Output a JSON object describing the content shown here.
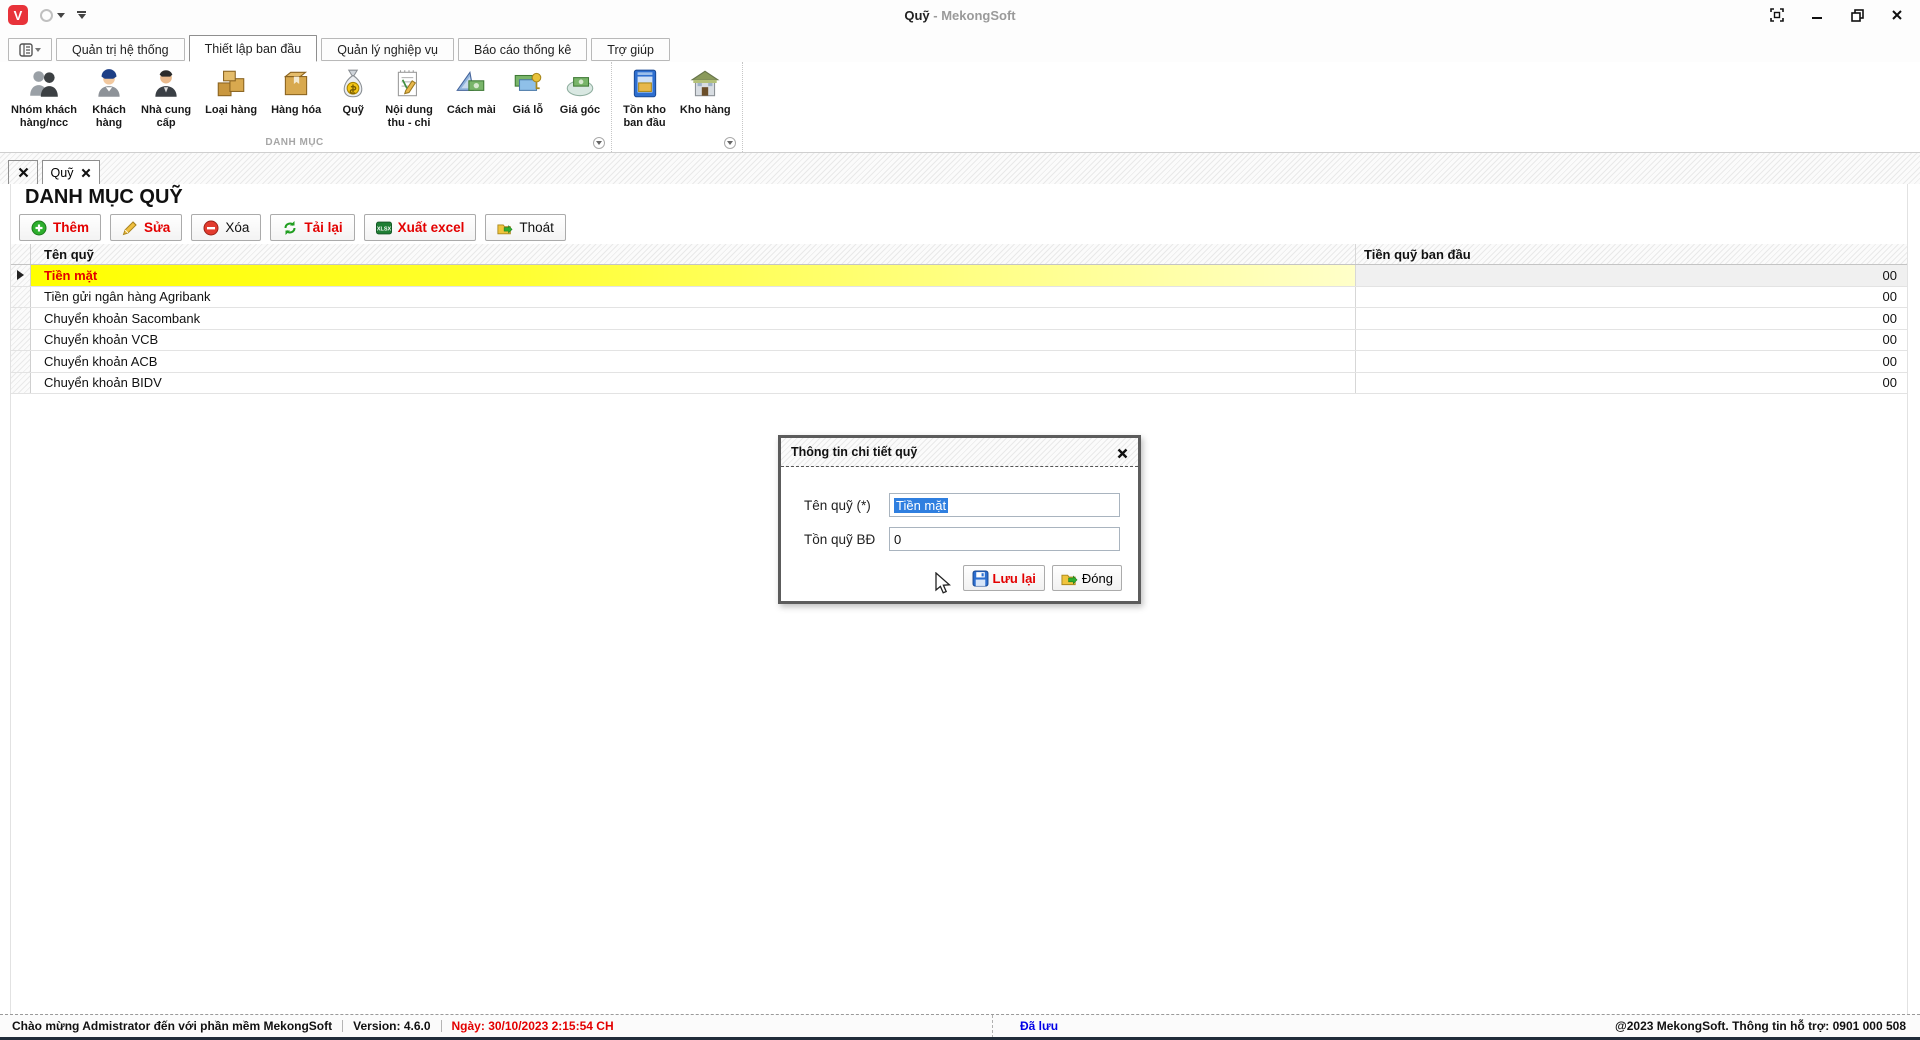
{
  "window": {
    "title": "Quỹ",
    "title_suffix": " - MekongSoft"
  },
  "menu_tabs": {
    "items": [
      {
        "label": "Quản trị hệ thống",
        "active": false
      },
      {
        "label": "Thiết lập ban đầu",
        "active": true
      },
      {
        "label": "Quản lý nghiệp vụ",
        "active": false
      },
      {
        "label": "Báo cáo thống kê",
        "active": false
      },
      {
        "label": "Trợ giúp",
        "active": false
      }
    ]
  },
  "ribbon": {
    "group_label": "DANH MỤC",
    "items": [
      {
        "label": "Nhóm khách\nhàng/ncc",
        "icon": "customers-group-icon",
        "group": 1
      },
      {
        "label": "Khách\nhàng",
        "icon": "customer-icon",
        "group": 1
      },
      {
        "label": "Nhà cung\ncấp",
        "icon": "supplier-icon",
        "group": 1
      },
      {
        "label": "Loại hàng",
        "icon": "item-type-icon",
        "group": 1
      },
      {
        "label": "Hàng hóa",
        "icon": "goods-icon",
        "group": 1
      },
      {
        "label": "Quỹ",
        "icon": "fund-icon",
        "group": 1
      },
      {
        "label": "Nội dung\nthu - chi",
        "icon": "income-expense-icon",
        "group": 1
      },
      {
        "label": "Cách mài",
        "icon": "promotion-icon",
        "group": 1
      },
      {
        "label": "Giá lỗ",
        "icon": "retail-price-icon",
        "group": 1
      },
      {
        "label": "Giá góc",
        "icon": "cost-price-icon",
        "group": 1
      },
      {
        "label": "Tồn kho\nban đầu",
        "icon": "initial-stock-icon",
        "group": 2
      },
      {
        "label": "Kho hàng",
        "icon": "warehouse-icon",
        "group": 2
      }
    ]
  },
  "doc_tabs": {
    "active_label": "Quỹ"
  },
  "page": {
    "title": "DANH MỤC QUỸ"
  },
  "actions": [
    {
      "label": "Thêm",
      "icon": "add-icon",
      "emphasis": true
    },
    {
      "label": "Sửa",
      "icon": "edit-icon",
      "emphasis": true
    },
    {
      "label": "Xóa",
      "icon": "delete-icon",
      "emphasis": false
    },
    {
      "label": "Tải lại",
      "icon": "reload-icon",
      "emphasis": true
    },
    {
      "label": "Xuất excel",
      "icon": "excel-icon",
      "emphasis": true
    },
    {
      "label": "Thoát",
      "icon": "exit-icon",
      "emphasis": false
    }
  ],
  "table": {
    "columns": [
      "Tên quỹ",
      "Tiền quỹ ban đầu"
    ],
    "rows": [
      {
        "name": "Tiền mặt",
        "initial_fund": "00",
        "selected": true
      },
      {
        "name": "Tiền gửi ngân hàng Agribank",
        "initial_fund": "00",
        "selected": false
      },
      {
        "name": "Chuyển khoản Sacombank",
        "initial_fund": "00",
        "selected": false
      },
      {
        "name": "Chuyển khoản VCB",
        "initial_fund": "00",
        "selected": false
      },
      {
        "name": "Chuyển khoản ACB",
        "initial_fund": "00",
        "selected": false
      },
      {
        "name": "Chuyển khoản BIDV",
        "initial_fund": "00",
        "selected": false
      }
    ]
  },
  "dialog": {
    "title": "Thông tin chi tiết quỹ",
    "fields": [
      {
        "label": "Tên quỹ (*)",
        "value": "Tiền mặt",
        "text_selected": true
      },
      {
        "label": "Tồn quỹ BĐ",
        "value": "0",
        "text_selected": false
      }
    ],
    "save_label": "Lưu lại",
    "close_label": "Đóng"
  },
  "status_bar": {
    "welcome": "Chào mừng Admistrator đến với phần mềm MekongSoft",
    "version": "Version: 4.6.0",
    "date": "Ngày: 30/10/2023 2:15:54 CH",
    "saved": "Đã lưu",
    "support": "@2023 MekongSoft. Thông tin hỗ trợ: 0901 000 508"
  },
  "colors": {
    "selected_row_start": "#ffff00",
    "selected_row_end": "#ffffc9",
    "accent_red": "#e30000",
    "saved_blue": "#0000e6"
  }
}
